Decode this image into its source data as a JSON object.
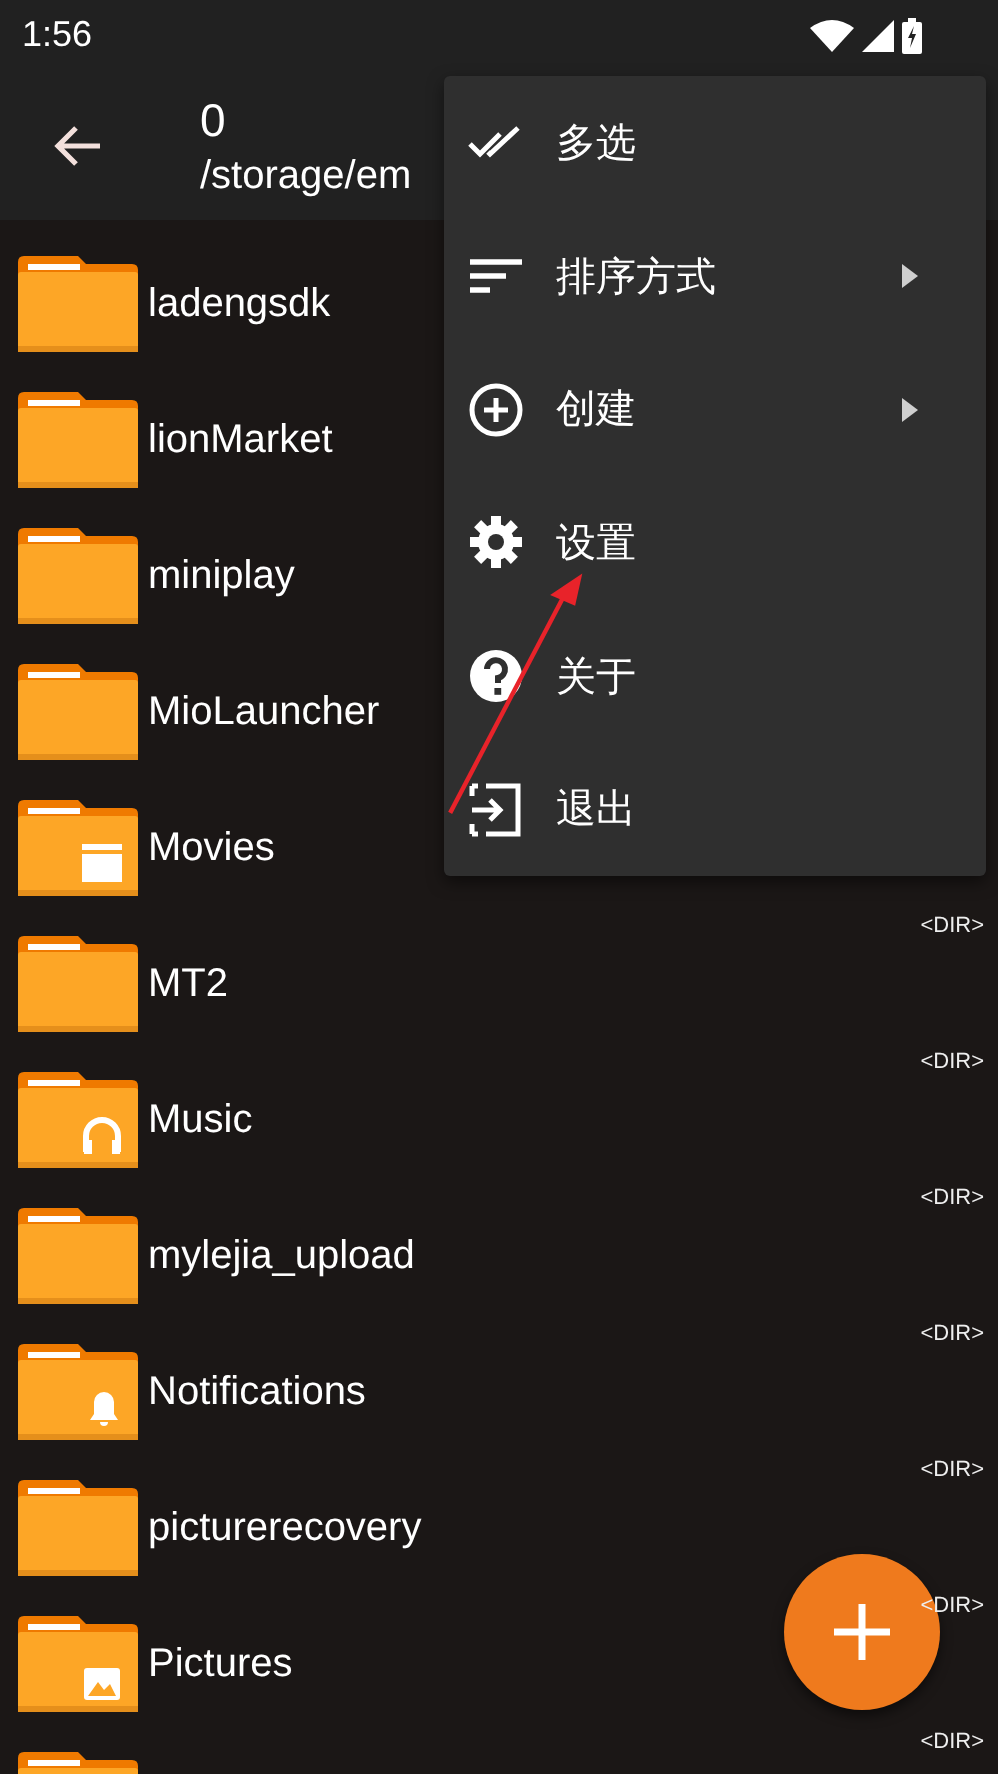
{
  "status_bar": {
    "time": "1:56"
  },
  "header": {
    "title": "0",
    "path": "/storage/em"
  },
  "folders": [
    {
      "name": "ladengsdk",
      "kind": "plain"
    },
    {
      "name": "lionMarket",
      "kind": "plain"
    },
    {
      "name": "miniplay",
      "kind": "plain"
    },
    {
      "name": "MioLauncher",
      "kind": "plain"
    },
    {
      "name": "Movies",
      "kind": "movie",
      "dir": "<DIR>"
    },
    {
      "name": "MT2",
      "kind": "plain",
      "dir": "<DIR>"
    },
    {
      "name": "Music",
      "kind": "music",
      "dir": "<DIR>"
    },
    {
      "name": "mylejia_upload",
      "kind": "plain",
      "dir": "<DIR>"
    },
    {
      "name": "Notifications",
      "kind": "bell",
      "dir": "<DIR>"
    },
    {
      "name": "picturerecovery",
      "kind": "plain",
      "dir": "<DIR>"
    },
    {
      "name": "Pictures",
      "kind": "image",
      "dir": "<DIR>"
    },
    {
      "kind": "plain"
    }
  ],
  "menu": [
    {
      "label": "多选",
      "kind": "double-check",
      "submenu": false
    },
    {
      "label": "排序方式",
      "kind": "sort",
      "submenu": true
    },
    {
      "label": "创建",
      "kind": "add",
      "submenu": true
    },
    {
      "label": "设置",
      "kind": "gear",
      "submenu": false
    },
    {
      "label": "关于",
      "kind": "help",
      "submenu": false
    },
    {
      "label": "退出",
      "kind": "exit",
      "submenu": false
    }
  ]
}
